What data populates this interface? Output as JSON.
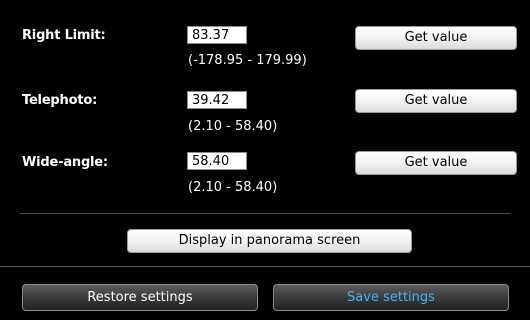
{
  "rows": [
    {
      "label": "Right Limit:",
      "value": "83.37",
      "range": "(-178.95 - 179.99)",
      "button": "Get value"
    },
    {
      "label": "Telephoto:",
      "value": "39.42",
      "range": "(2.10 - 58.40)",
      "button": "Get value"
    },
    {
      "label": "Wide-angle:",
      "value": "58.40",
      "range": "(2.10 - 58.40)",
      "button": "Get value"
    }
  ],
  "panorama_button": "Display in panorama screen",
  "footer": {
    "restore_label": "Restore settings",
    "save_label": "Save settings",
    "restore_color": "#ffffff",
    "save_color": "#3fb6f2"
  }
}
